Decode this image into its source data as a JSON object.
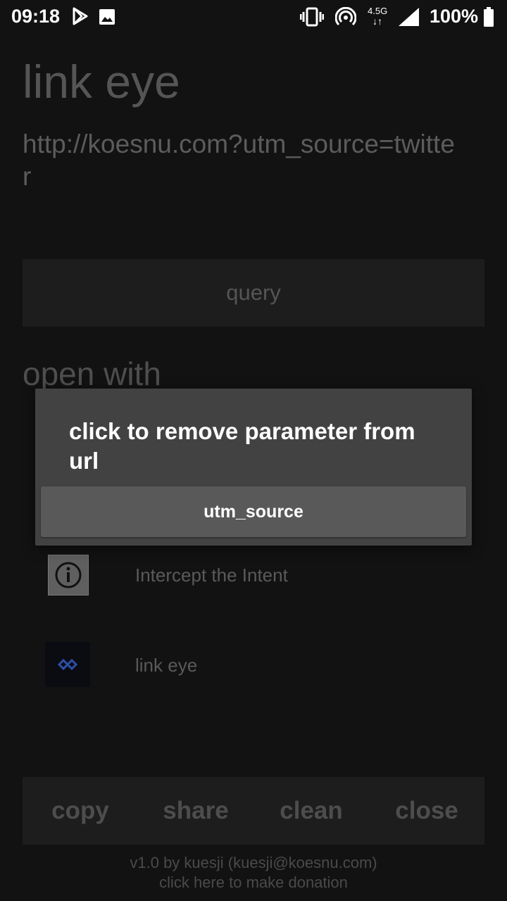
{
  "status_bar": {
    "time": "09:18",
    "network": "4.5G",
    "battery": "100%"
  },
  "app": {
    "title": "link eye",
    "url": "http://koesnu.com?utm_source=twitter",
    "query_label": "query",
    "open_with_label": "open with",
    "apps": [
      {
        "label": "Intercept the Intent",
        "icon": "info-icon"
      },
      {
        "label": "link eye",
        "icon": "link-eye-icon"
      }
    ],
    "actions": {
      "copy": "copy",
      "share": "share",
      "clean": "clean",
      "close": "close"
    },
    "footer": {
      "credit": "v1.0 by kuesji (kuesji@koesnu.com)",
      "donation": "click here to make donation"
    }
  },
  "dialog": {
    "title": "click to remove parameter from url",
    "items": [
      "utm_source"
    ]
  },
  "colors": {
    "background": "#121212",
    "dialog_bg": "#424242",
    "dialog_item_bg": "#595959",
    "accent_icon": "#2d4fa8"
  }
}
